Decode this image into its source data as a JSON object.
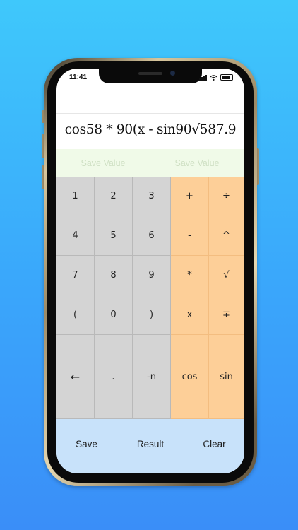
{
  "status_bar": {
    "time": "11:41"
  },
  "display": {
    "expression": "cos58 * 90(x - sin90√587.9"
  },
  "save_values": [
    "Save Value",
    "Save Value"
  ],
  "keypad": {
    "rows": [
      [
        {
          "label": "1",
          "kind": "num",
          "name": "key-1"
        },
        {
          "label": "2",
          "kind": "num",
          "name": "key-2"
        },
        {
          "label": "3",
          "kind": "num",
          "name": "key-3"
        },
        {
          "label": "+",
          "kind": "op",
          "name": "key-plus"
        },
        {
          "label": "÷",
          "kind": "op",
          "name": "key-divide"
        }
      ],
      [
        {
          "label": "4",
          "kind": "num",
          "name": "key-4"
        },
        {
          "label": "5",
          "kind": "num",
          "name": "key-5"
        },
        {
          "label": "6",
          "kind": "num",
          "name": "key-6"
        },
        {
          "label": "-",
          "kind": "op",
          "name": "key-minus"
        },
        {
          "label": "^",
          "kind": "op",
          "name": "key-power"
        }
      ],
      [
        {
          "label": "7",
          "kind": "num",
          "name": "key-7"
        },
        {
          "label": "8",
          "kind": "num",
          "name": "key-8"
        },
        {
          "label": "9",
          "kind": "num",
          "name": "key-9"
        },
        {
          "label": "*",
          "kind": "op",
          "name": "key-multiply"
        },
        {
          "label": "√",
          "kind": "op",
          "name": "key-sqrt"
        }
      ],
      [
        {
          "label": "(",
          "kind": "num",
          "name": "key-open-paren"
        },
        {
          "label": "0",
          "kind": "num",
          "name": "key-0"
        },
        {
          "label": ")",
          "kind": "num",
          "name": "key-close-paren"
        },
        {
          "label": "x",
          "kind": "op",
          "name": "key-variable-x"
        },
        {
          "label": "∓",
          "kind": "op",
          "name": "key-plus-minus"
        }
      ],
      [
        {
          "label": "←",
          "kind": "num",
          "name": "key-backspace"
        },
        {
          "label": ".",
          "kind": "num",
          "name": "key-decimal"
        },
        {
          "label": "-n",
          "kind": "num",
          "name": "key-negate"
        },
        {
          "label": "cos",
          "kind": "op",
          "name": "key-cos"
        },
        {
          "label": "sin",
          "kind": "op",
          "name": "key-sin"
        }
      ]
    ]
  },
  "bottom_buttons": [
    "Save",
    "Result",
    "Clear"
  ],
  "colors": {
    "number_key": "#d4d4d4",
    "operator_key": "#fdcf98",
    "bottom_button": "#c8e2fa",
    "save_value_bg": "#f0fae8",
    "background_top": "#3fc8fb",
    "background_bottom": "#3a8ef8"
  }
}
